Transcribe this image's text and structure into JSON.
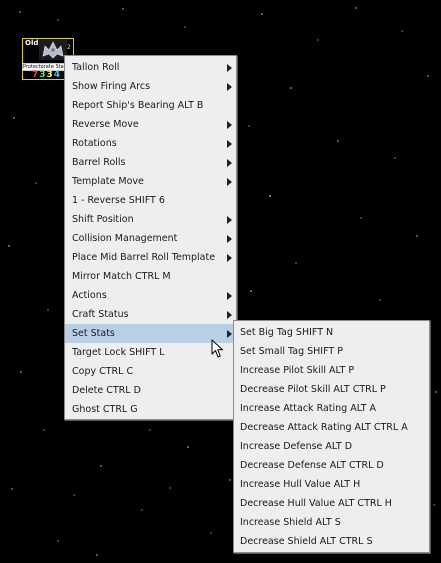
{
  "token": {
    "tag": "Old",
    "small_number": "2",
    "name": "Protectorate Starfighter",
    "stats": [
      "7",
      "3",
      "3",
      "4"
    ]
  },
  "main_menu": {
    "items": [
      {
        "label": "Tallon Roll",
        "submenu": true
      },
      {
        "label": "Show Firing Arcs",
        "submenu": true
      },
      {
        "label": "Report Ship's Bearing  ALT B",
        "submenu": false
      },
      {
        "label": "Reverse Move",
        "submenu": true
      },
      {
        "label": "Rotations",
        "submenu": true
      },
      {
        "label": "Barrel Rolls",
        "submenu": true
      },
      {
        "label": "Template Move",
        "submenu": true
      },
      {
        "label": "1 - Reverse  SHIFT 6",
        "submenu": false
      },
      {
        "label": "Shift Position",
        "submenu": true
      },
      {
        "label": "Collision Management",
        "submenu": true
      },
      {
        "label": "Place Mid Barrel Roll Template",
        "submenu": true
      },
      {
        "label": "Mirror Match  CTRL M",
        "submenu": false
      },
      {
        "label": "Actions",
        "submenu": true
      },
      {
        "label": "Craft Status",
        "submenu": true
      },
      {
        "label": "Set Stats",
        "submenu": true
      },
      {
        "label": "Target Lock  SHIFT L",
        "submenu": false
      },
      {
        "label": "Copy  CTRL C",
        "submenu": false
      },
      {
        "label": "Delete  CTRL D",
        "submenu": false
      },
      {
        "label": "Ghost  CTRL G",
        "submenu": false
      }
    ]
  },
  "sub_menu": {
    "items": [
      "Set Big Tag  SHIFT N",
      "Set Small Tag  SHIFT P",
      "Increase Pilot Skill  ALT P",
      "Decrease Pilot Skill  ALT CTRL P",
      "Increase Attack Rating  ALT A",
      "Decrease Attack Rating  ALT CTRL A",
      "Increase Defense  ALT D",
      "Decrease Defense  ALT CTRL D",
      "Increase Hull Value  ALT H",
      "Decrease Hull Value  ALT CTRL H",
      "Increase Shield  ALT S",
      "Decrease Shield  ALT CTRL S"
    ]
  },
  "colors": {
    "menu_background": "#eeeeee",
    "menu_highlight": "#b8cfe5",
    "token_border": "#e0d000"
  }
}
